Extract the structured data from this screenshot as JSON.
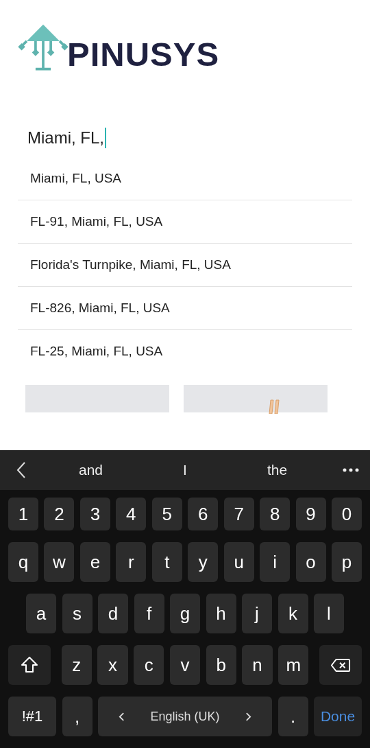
{
  "logo": {
    "text": "PINUSYS"
  },
  "search": {
    "value": "Miami, FL,"
  },
  "suggestions": [
    {
      "label": "Miami, FL, USA"
    },
    {
      "label": "FL-91, Miami, FL, USA"
    },
    {
      "label": "Florida's Turnpike, Miami, FL, USA"
    },
    {
      "label": "FL-826, Miami, FL, USA"
    },
    {
      "label": "FL-25, Miami, FL, USA"
    }
  ],
  "keyboard": {
    "word_suggestions": [
      "and",
      "I",
      "the"
    ],
    "rows": [
      [
        {
          "kind": "char",
          "label": "1"
        },
        {
          "kind": "char",
          "label": "2"
        },
        {
          "kind": "char",
          "label": "3"
        },
        {
          "kind": "char",
          "label": "4"
        },
        {
          "kind": "char",
          "label": "5"
        },
        {
          "kind": "char",
          "label": "6"
        },
        {
          "kind": "char",
          "label": "7"
        },
        {
          "kind": "char",
          "label": "8"
        },
        {
          "kind": "char",
          "label": "9"
        },
        {
          "kind": "char",
          "label": "0"
        }
      ],
      [
        {
          "kind": "char",
          "label": "q"
        },
        {
          "kind": "char",
          "label": "w"
        },
        {
          "kind": "char",
          "label": "e"
        },
        {
          "kind": "char",
          "label": "r"
        },
        {
          "kind": "char",
          "label": "t"
        },
        {
          "kind": "char",
          "label": "y"
        },
        {
          "kind": "char",
          "label": "u"
        },
        {
          "kind": "char",
          "label": "i"
        },
        {
          "kind": "char",
          "label": "o"
        },
        {
          "kind": "char",
          "label": "p"
        }
      ],
      [
        {
          "kind": "char",
          "label": "a"
        },
        {
          "kind": "char",
          "label": "s"
        },
        {
          "kind": "char",
          "label": "d"
        },
        {
          "kind": "char",
          "label": "f"
        },
        {
          "kind": "char",
          "label": "g"
        },
        {
          "kind": "char",
          "label": "h"
        },
        {
          "kind": "char",
          "label": "j"
        },
        {
          "kind": "char",
          "label": "k"
        },
        {
          "kind": "char",
          "label": "l"
        }
      ],
      [
        {
          "kind": "shift"
        },
        {
          "kind": "char",
          "label": "z"
        },
        {
          "kind": "char",
          "label": "x"
        },
        {
          "kind": "char",
          "label": "c"
        },
        {
          "kind": "char",
          "label": "v"
        },
        {
          "kind": "char",
          "label": "b"
        },
        {
          "kind": "char",
          "label": "n"
        },
        {
          "kind": "char",
          "label": "m"
        },
        {
          "kind": "backspace"
        }
      ]
    ],
    "bottom_row": [
      {
        "kind": "symbols",
        "label": "!#1"
      },
      {
        "kind": "char",
        "label": ","
      },
      {
        "kind": "space",
        "label": "English (UK)"
      },
      {
        "kind": "char",
        "label": "."
      },
      {
        "kind": "done",
        "label": "Done"
      }
    ]
  }
}
